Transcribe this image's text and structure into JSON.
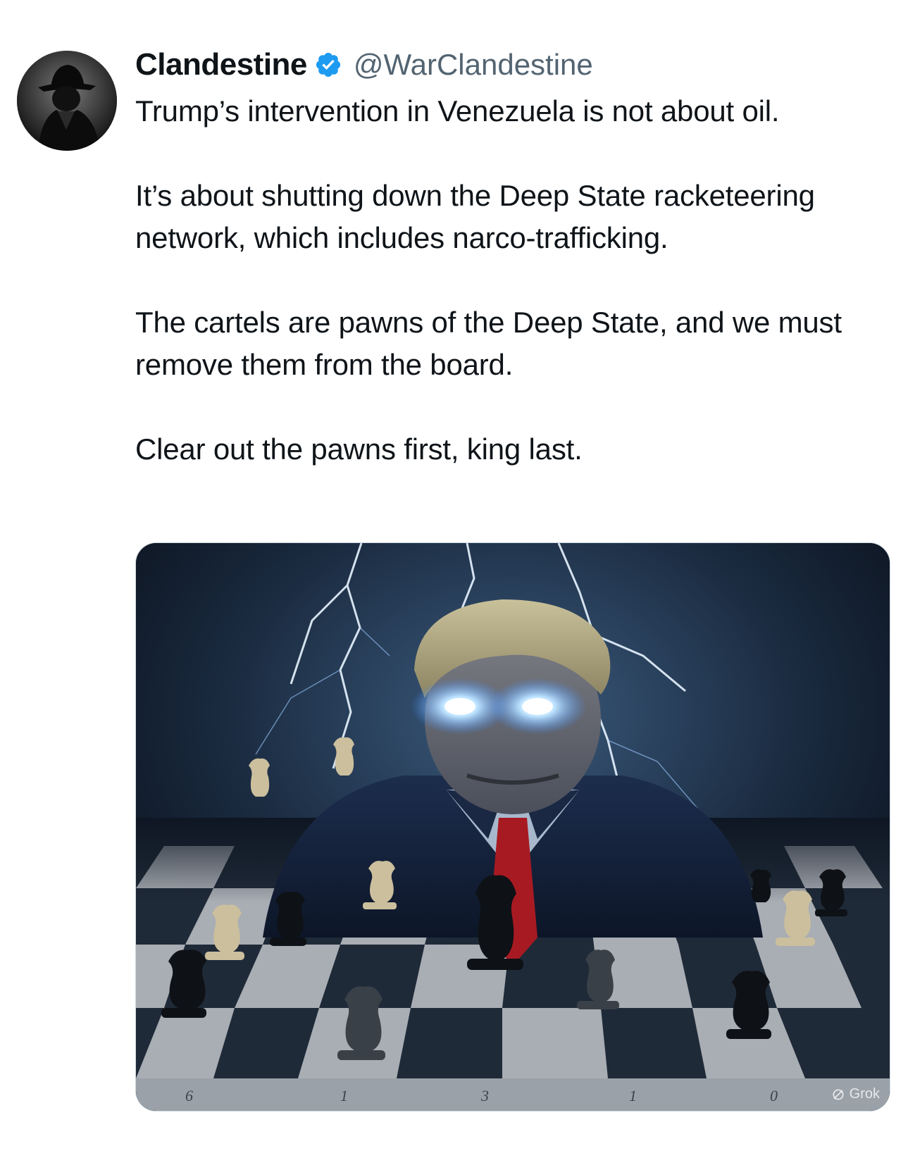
{
  "author": {
    "display_name": "Clandestine",
    "handle": "@WarClandestine",
    "verified": true,
    "avatar_icon": "spy-silhouette-avatar"
  },
  "tweet": {
    "paragraphs": [
      "Trump’s intervention in Venezuela is not about oil.",
      "It’s about shutting down the Deep State racketeering network, which includes narco-trafficking.",
      "The cartels are pawns of the Deep State, and we must remove them from the board.",
      "Clear out the pawns first, king last."
    ]
  },
  "media": {
    "watermark": "Grok",
    "board_numbers": [
      "6",
      "1",
      "3",
      "1",
      "0"
    ]
  },
  "colors": {
    "text": "#0f1419",
    "handle": "#536471",
    "verified": "#1d9bf0"
  }
}
